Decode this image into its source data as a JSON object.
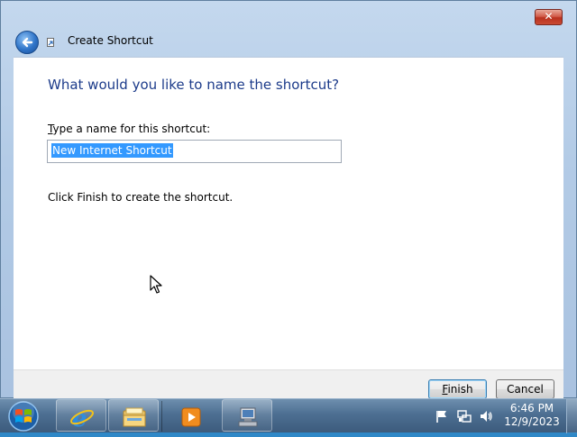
{
  "window": {
    "title": "Create Shortcut",
    "close_symbol": "✕"
  },
  "wizard": {
    "heading": "What would you like to name the shortcut?",
    "name_label_accesskey": "T",
    "name_label_rest": "ype a name for this shortcut:",
    "name_value": "New Internet Shortcut",
    "hint": "Click Finish to create the shortcut."
  },
  "buttons": {
    "finish_accesskey": "F",
    "finish_rest": "inish",
    "cancel": "Cancel"
  },
  "taskbar": {
    "pinned": [
      {
        "icon": "internet-explorer-icon"
      },
      {
        "icon": "windows-explorer-icon"
      },
      {
        "icon": "media-player-icon"
      },
      {
        "icon": "network-program-icon"
      }
    ],
    "clock_time": "6:46 PM",
    "clock_date": "12/9/2023"
  },
  "colors": {
    "heading": "#1c3b8a",
    "selection": "#3399ff",
    "taskbar": "#4d6f92"
  }
}
